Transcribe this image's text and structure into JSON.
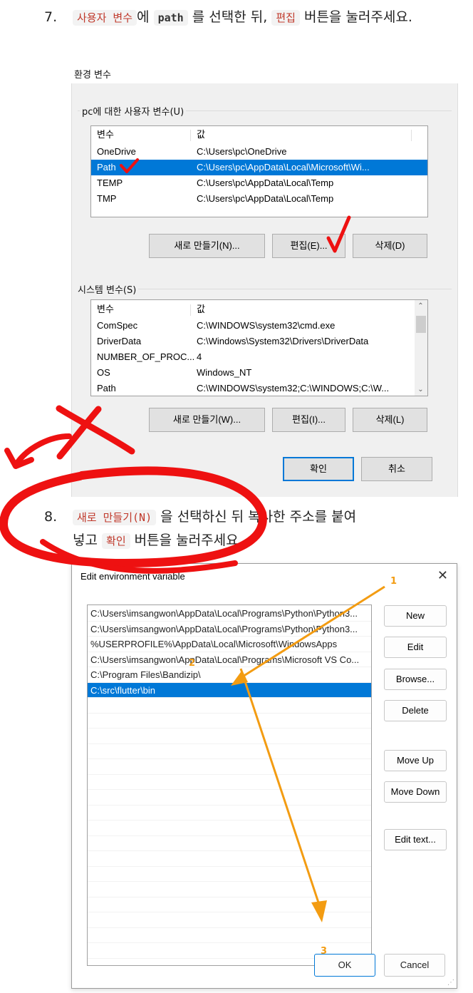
{
  "step7": {
    "number": "7.",
    "code_user_vars": "사용자 변수",
    "text_1": "에",
    "code_path": "path",
    "text_2": "를 선택한 뒤,",
    "code_edit": "편집",
    "text_3": "버튼을 눌러주세요."
  },
  "env_dialog": {
    "title": "환경 변수",
    "user_group_label": "pc에 대한 사용자 변수(U)",
    "col_var": "변수",
    "col_val": "값",
    "user_vars": [
      {
        "name": "OneDrive",
        "value": "C:\\Users\\pc\\OneDrive",
        "selected": false
      },
      {
        "name": "Path",
        "value": "C:\\Users\\pc\\AppData\\Local\\Microsoft\\Wi...",
        "selected": true
      },
      {
        "name": "TEMP",
        "value": "C:\\Users\\pc\\AppData\\Local\\Temp",
        "selected": false
      },
      {
        "name": "TMP",
        "value": "C:\\Users\\pc\\AppData\\Local\\Temp",
        "selected": false
      }
    ],
    "user_buttons": {
      "new": "새로 만들기(N)...",
      "edit": "편집(E)...",
      "delete": "삭제(D)"
    },
    "system_group_label": "시스템 변수(S)",
    "system_vars": [
      {
        "name": "ComSpec",
        "value": "C:\\WINDOWS\\system32\\cmd.exe",
        "selected": false
      },
      {
        "name": "DriverData",
        "value": "C:\\Windows\\System32\\Drivers\\DriverData",
        "selected": false
      },
      {
        "name": "NUMBER_OF_PROC...",
        "value": "4",
        "selected": false
      },
      {
        "name": "OS",
        "value": "Windows_NT",
        "selected": false
      },
      {
        "name": "Path",
        "value": "C:\\WINDOWS\\system32;C:\\WINDOWS;C:\\W...",
        "selected": false
      }
    ],
    "system_buttons": {
      "new": "새로 만들기(W)...",
      "edit": "편집(I)...",
      "delete": "삭제(L)"
    },
    "ok": "확인",
    "cancel": "취소"
  },
  "step8": {
    "number": "8.",
    "code_new": "새로 만들기(N)",
    "text_1": "을 선택하신 뒤 복사한 주소를 붙여",
    "text_2": "넣고",
    "code_ok": "확인",
    "text_3": "버튼을 눌러주세요."
  },
  "edit_dialog": {
    "title": "Edit environment variable",
    "close_glyph": "✕",
    "entries": [
      {
        "text": "C:\\Users\\imsangwon\\AppData\\Local\\Programs\\Python\\Python3...",
        "selected": false
      },
      {
        "text": "C:\\Users\\imsangwon\\AppData\\Local\\Programs\\Python\\Python3...",
        "selected": false
      },
      {
        "text": "%USERPROFILE%\\AppData\\Local\\Microsoft\\WindowsApps",
        "selected": false
      },
      {
        "text": "C:\\Users\\imsangwon\\AppData\\Local\\Programs\\Microsoft VS Co...",
        "selected": false
      },
      {
        "text": "C:\\Program Files\\Bandizip\\",
        "selected": false
      },
      {
        "text": "C:\\src\\flutter\\bin",
        "selected": true
      }
    ],
    "buttons": {
      "new": "New",
      "edit": "Edit",
      "browse": "Browse...",
      "delete": "Delete",
      "move_up": "Move Up",
      "move_down": "Move Down",
      "edit_text": "Edit text..."
    },
    "ok": "OK",
    "cancel": "Cancel"
  },
  "annotations": {
    "num1": "1",
    "num2": "2",
    "num3": "3",
    "arrow_color": "#f39c12",
    "scribble_color": "#ee1111"
  }
}
